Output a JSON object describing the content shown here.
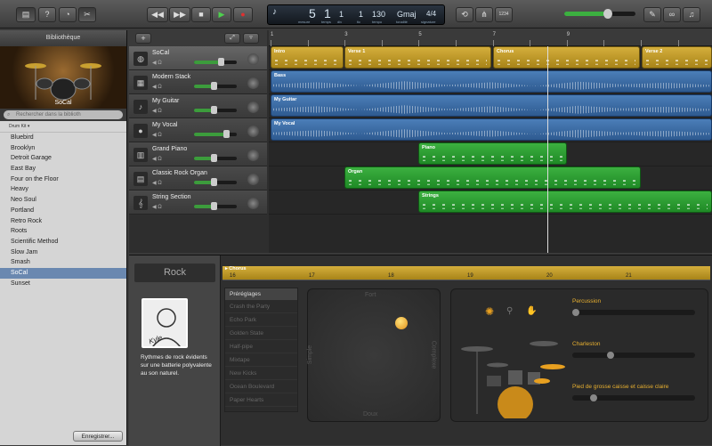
{
  "toolbar": {
    "buttons": [
      "library-icon",
      "help-icon",
      "smart-controls-icon",
      "editors-icon"
    ],
    "transport": {
      "rewind": "◀◀",
      "forward": "▶▶",
      "stop": "■",
      "play": "▶",
      "record": "●"
    },
    "lcd": {
      "bar": "5",
      "beat": "1",
      "division": "1",
      "tick": "1",
      "tempo": "130",
      "key": "Gmaj",
      "signature": "4/4",
      "labels": {
        "bar": "mesure",
        "beat": "temps",
        "division": "div",
        "tick": "tic",
        "tempo": "tempo",
        "key": "tonalité",
        "signature": "signature"
      }
    },
    "count_in": "1234"
  },
  "library": {
    "title": "Bibliothèque",
    "preview_label": "SoCal",
    "search_placeholder": "Rechercher dans la biblioth",
    "category": "Drum Kit",
    "items": [
      "Bluebird",
      "Brooklyn",
      "Detroit Garage",
      "East Bay",
      "Four on the Floor",
      "Heavy",
      "Neo Soul",
      "Portland",
      "Retro Rock",
      "Roots",
      "Scientific Method",
      "Slow Jam",
      "Smash",
      "SoCal",
      "Sunset"
    ],
    "selected": "SoCal",
    "save_label": "Enregistrer..."
  },
  "tracks": [
    {
      "name": "SoCal",
      "icon": "drum-kit-icon",
      "volume": 0.62
    },
    {
      "name": "Modern Stack",
      "icon": "amp-icon",
      "volume": 0.45
    },
    {
      "name": "My Guitar",
      "icon": "guitar-icon",
      "volume": 0.45
    },
    {
      "name": "My Vocal",
      "icon": "microphone-icon",
      "volume": 0.75
    },
    {
      "name": "Grand Piano",
      "icon": "piano-icon",
      "volume": 0.45
    },
    {
      "name": "Classic Rock Organ",
      "icon": "organ-icon",
      "volume": 0.45
    },
    {
      "name": "String Section",
      "icon": "strings-icon",
      "volume": 0.45
    }
  ],
  "ruler": {
    "bars": [
      "1",
      "3",
      "5",
      "7",
      "9"
    ]
  },
  "regions": {
    "drums": [
      "Intro",
      "Verse 1",
      "Chorus",
      "Verse 2"
    ],
    "bass": "Bass",
    "guitar": "My Guitar",
    "vocal": "My Vocal",
    "piano": "Piano",
    "organ": "Organ",
    "strings": "Strings"
  },
  "editor": {
    "genre": "Rock",
    "drummer_name": "Kyle",
    "description": "Rythmes de rock évidents sur une batterie polyvalente au son naturel.",
    "region_label": "Chorus",
    "ruler_ticks": [
      "16",
      "17",
      "18",
      "19",
      "20",
      "21"
    ],
    "presets_title": "Préréglages",
    "presets": [
      "Crash the Party",
      "Echo Park",
      "Golden State",
      "Half-pipe",
      "Mixtape",
      "New Kicks",
      "Ocean Boulevard",
      "Paper Hearts"
    ],
    "xy_labels": {
      "top": "Fort",
      "bottom": "Doux",
      "left": "Simple",
      "right": "Complexe"
    },
    "sliders": [
      {
        "label": "Percussion",
        "value": 0.0
      },
      {
        "label": "Charleston",
        "value": 0.3
      },
      {
        "label": "Pied de grosse caisse et caisse claire",
        "value": 0.15
      }
    ]
  }
}
